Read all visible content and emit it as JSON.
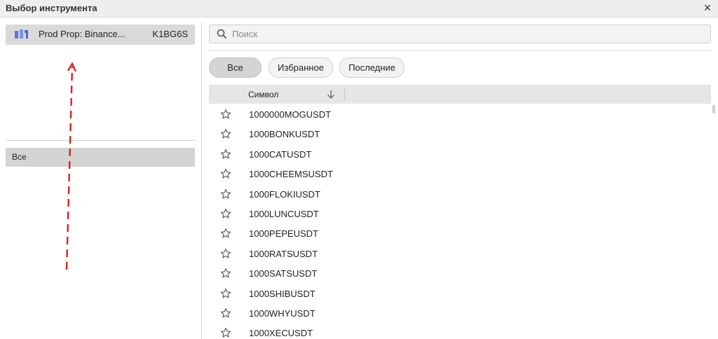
{
  "window": {
    "title": "Выбор инструмента",
    "close_icon": "close-icon"
  },
  "left_panel": {
    "account": {
      "icon": "broker-logo-icon",
      "name": "Prod Prop: Binance...",
      "id": "K1BG6S"
    },
    "group": {
      "label": "Все"
    },
    "annotation_arrow_color": "#e0201c"
  },
  "search": {
    "placeholder": "Поиск",
    "value": ""
  },
  "filters": [
    {
      "label": "Все",
      "selected": true
    },
    {
      "label": "Избранное",
      "selected": false
    },
    {
      "label": "Последние",
      "selected": false
    }
  ],
  "table": {
    "header": {
      "symbol": "Символ",
      "sort_icon": "arrow-down-icon"
    },
    "rows": [
      {
        "symbol": "1000000MOGUSDT"
      },
      {
        "symbol": "1000BONKUSDT"
      },
      {
        "symbol": "1000CATUSDT"
      },
      {
        "symbol": "1000CHEEMSUSDT"
      },
      {
        "symbol": "1000FLOKIUSDT"
      },
      {
        "symbol": "1000LUNCUSDT"
      },
      {
        "symbol": "1000PEPEUSDT"
      },
      {
        "symbol": "1000RATSUSDT"
      },
      {
        "symbol": "1000SATSUSDT"
      },
      {
        "symbol": "1000SHIBUSDT"
      },
      {
        "symbol": "1000WHYUSDT"
      },
      {
        "symbol": "1000XECUSDT"
      }
    ]
  }
}
